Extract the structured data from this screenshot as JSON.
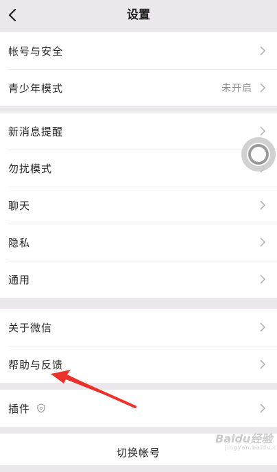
{
  "header": {
    "title": "设置",
    "back_icon": "chevron-left-icon"
  },
  "groups": [
    {
      "items": [
        {
          "label": "帐号与安全"
        },
        {
          "label": "青少年模式",
          "value": "未开启"
        }
      ]
    },
    {
      "items": [
        {
          "label": "新消息提醒"
        },
        {
          "label": "勿扰模式"
        },
        {
          "label": "聊天"
        },
        {
          "label": "隐私"
        },
        {
          "label": "通用"
        }
      ]
    },
    {
      "items": [
        {
          "label": "关于微信"
        },
        {
          "label": "帮助与反馈"
        }
      ]
    },
    {
      "items": [
        {
          "label": "插件",
          "icon": "shield-icon"
        }
      ]
    }
  ],
  "footer": {
    "switch_account": "切换帐号"
  },
  "watermark": {
    "brand": "Baidu经验",
    "url": "jingyan.baidu.com"
  },
  "colors": {
    "background": "#ebe7ed",
    "surface": "#ffffff",
    "annotation_arrow": "#e8322a"
  }
}
